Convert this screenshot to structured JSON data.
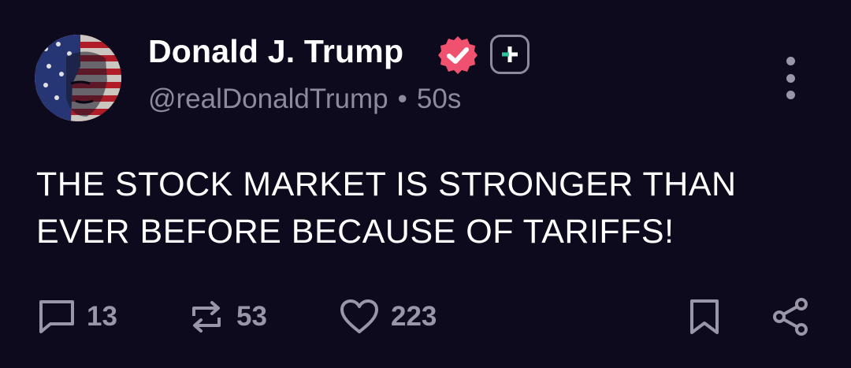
{
  "author": {
    "display_name": "Donald J. Trump",
    "handle": "@realDonaldTrump",
    "separator": "•",
    "timestamp": "50s",
    "avatar_icon": "flag-portrait-avatar",
    "verified_icon": "verified-badge-icon",
    "verified_color": "#f0516e",
    "plus_icon": "plus-badge-icon"
  },
  "post": {
    "text": "THE STOCK MARKET IS STRONGER THAN EVER BEFORE BECAUSE OF TARIFFS!"
  },
  "actions": {
    "reply_count": "13",
    "repost_count": "53",
    "like_count": "223"
  },
  "theme": {
    "background": "#0d0a1d",
    "text": "#ffffff",
    "muted": "#8e8a9c",
    "accent": "#f0516e",
    "plus_accent": "#27c79a"
  }
}
